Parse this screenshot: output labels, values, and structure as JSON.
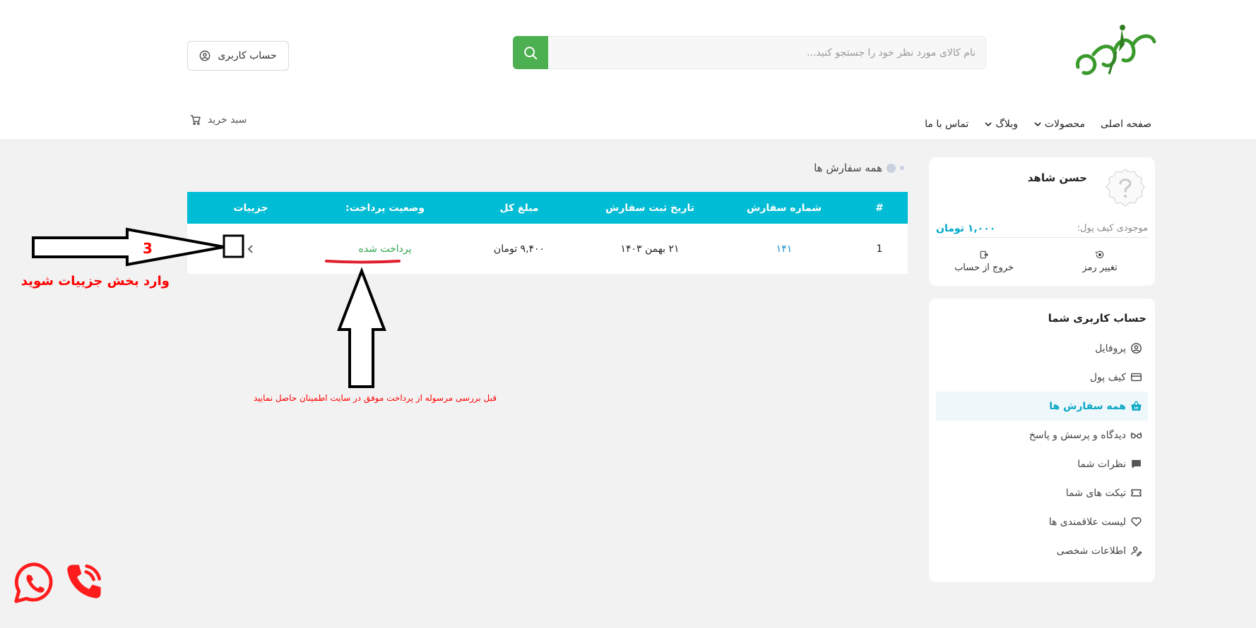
{
  "search": {
    "placeholder": "نام کالای مورد نظر خود را جستجو کنید..."
  },
  "header": {
    "account_label": "حساب کاربری",
    "cart_label": "سبد خرید"
  },
  "nav": {
    "items": [
      {
        "label": "صفحه اصلی"
      },
      {
        "label": "محصولات"
      },
      {
        "label": "وبلاگ"
      },
      {
        "label": "تماس با ما"
      }
    ]
  },
  "profile": {
    "name": "حسن شاهد",
    "wallet_label": "موجودی کیف پول:",
    "wallet_value": "۱,۰۰۰ تومان",
    "change_password": "تغییر رمز",
    "logout": "خروج از حساب"
  },
  "sidebar": {
    "title": "حساب کاربری شما",
    "items": [
      {
        "label": "پروفایل",
        "icon": "user-circle-icon"
      },
      {
        "label": "کیف پول",
        "icon": "credit-card-icon"
      },
      {
        "label": "همه سفارش ها",
        "icon": "basket-icon",
        "active": true
      },
      {
        "label": "دیدگاه و پرسش و پاسخ",
        "icon": "glasses-icon"
      },
      {
        "label": "نظرات شما",
        "icon": "comment-icon"
      },
      {
        "label": "تیکت های شما",
        "icon": "ticket-icon"
      },
      {
        "label": "لیست علاقمندی ها",
        "icon": "heart-icon"
      },
      {
        "label": "اطلاعات شخصی",
        "icon": "user-edit-icon"
      }
    ]
  },
  "orders": {
    "title": "همه سفارش ها",
    "columns": [
      "#",
      "شماره سفارش",
      "تاریخ ثبت سفارش",
      "مبلغ کل",
      "وضعیت پرداخت:",
      "جزییات"
    ],
    "rows": [
      {
        "index": "1",
        "order_no": "۱۴۱",
        "date": "۲۱ بهمن ۱۴۰۳",
        "total": "۹,۴۰۰ تومان",
        "status": "پرداخت شده"
      }
    ]
  },
  "annotations": {
    "step_number": "3",
    "details_hint": "وارد بخش جزییات شوید",
    "payment_hint": "قبل بررسی مرسوله از پرداخت موفق در سایت اطمینان حاصل نمایید"
  },
  "colors": {
    "accent": "#00bcd4",
    "search_button": "#4caf50",
    "paid": "#2ea44f",
    "annotation_red": "#ff0000"
  }
}
